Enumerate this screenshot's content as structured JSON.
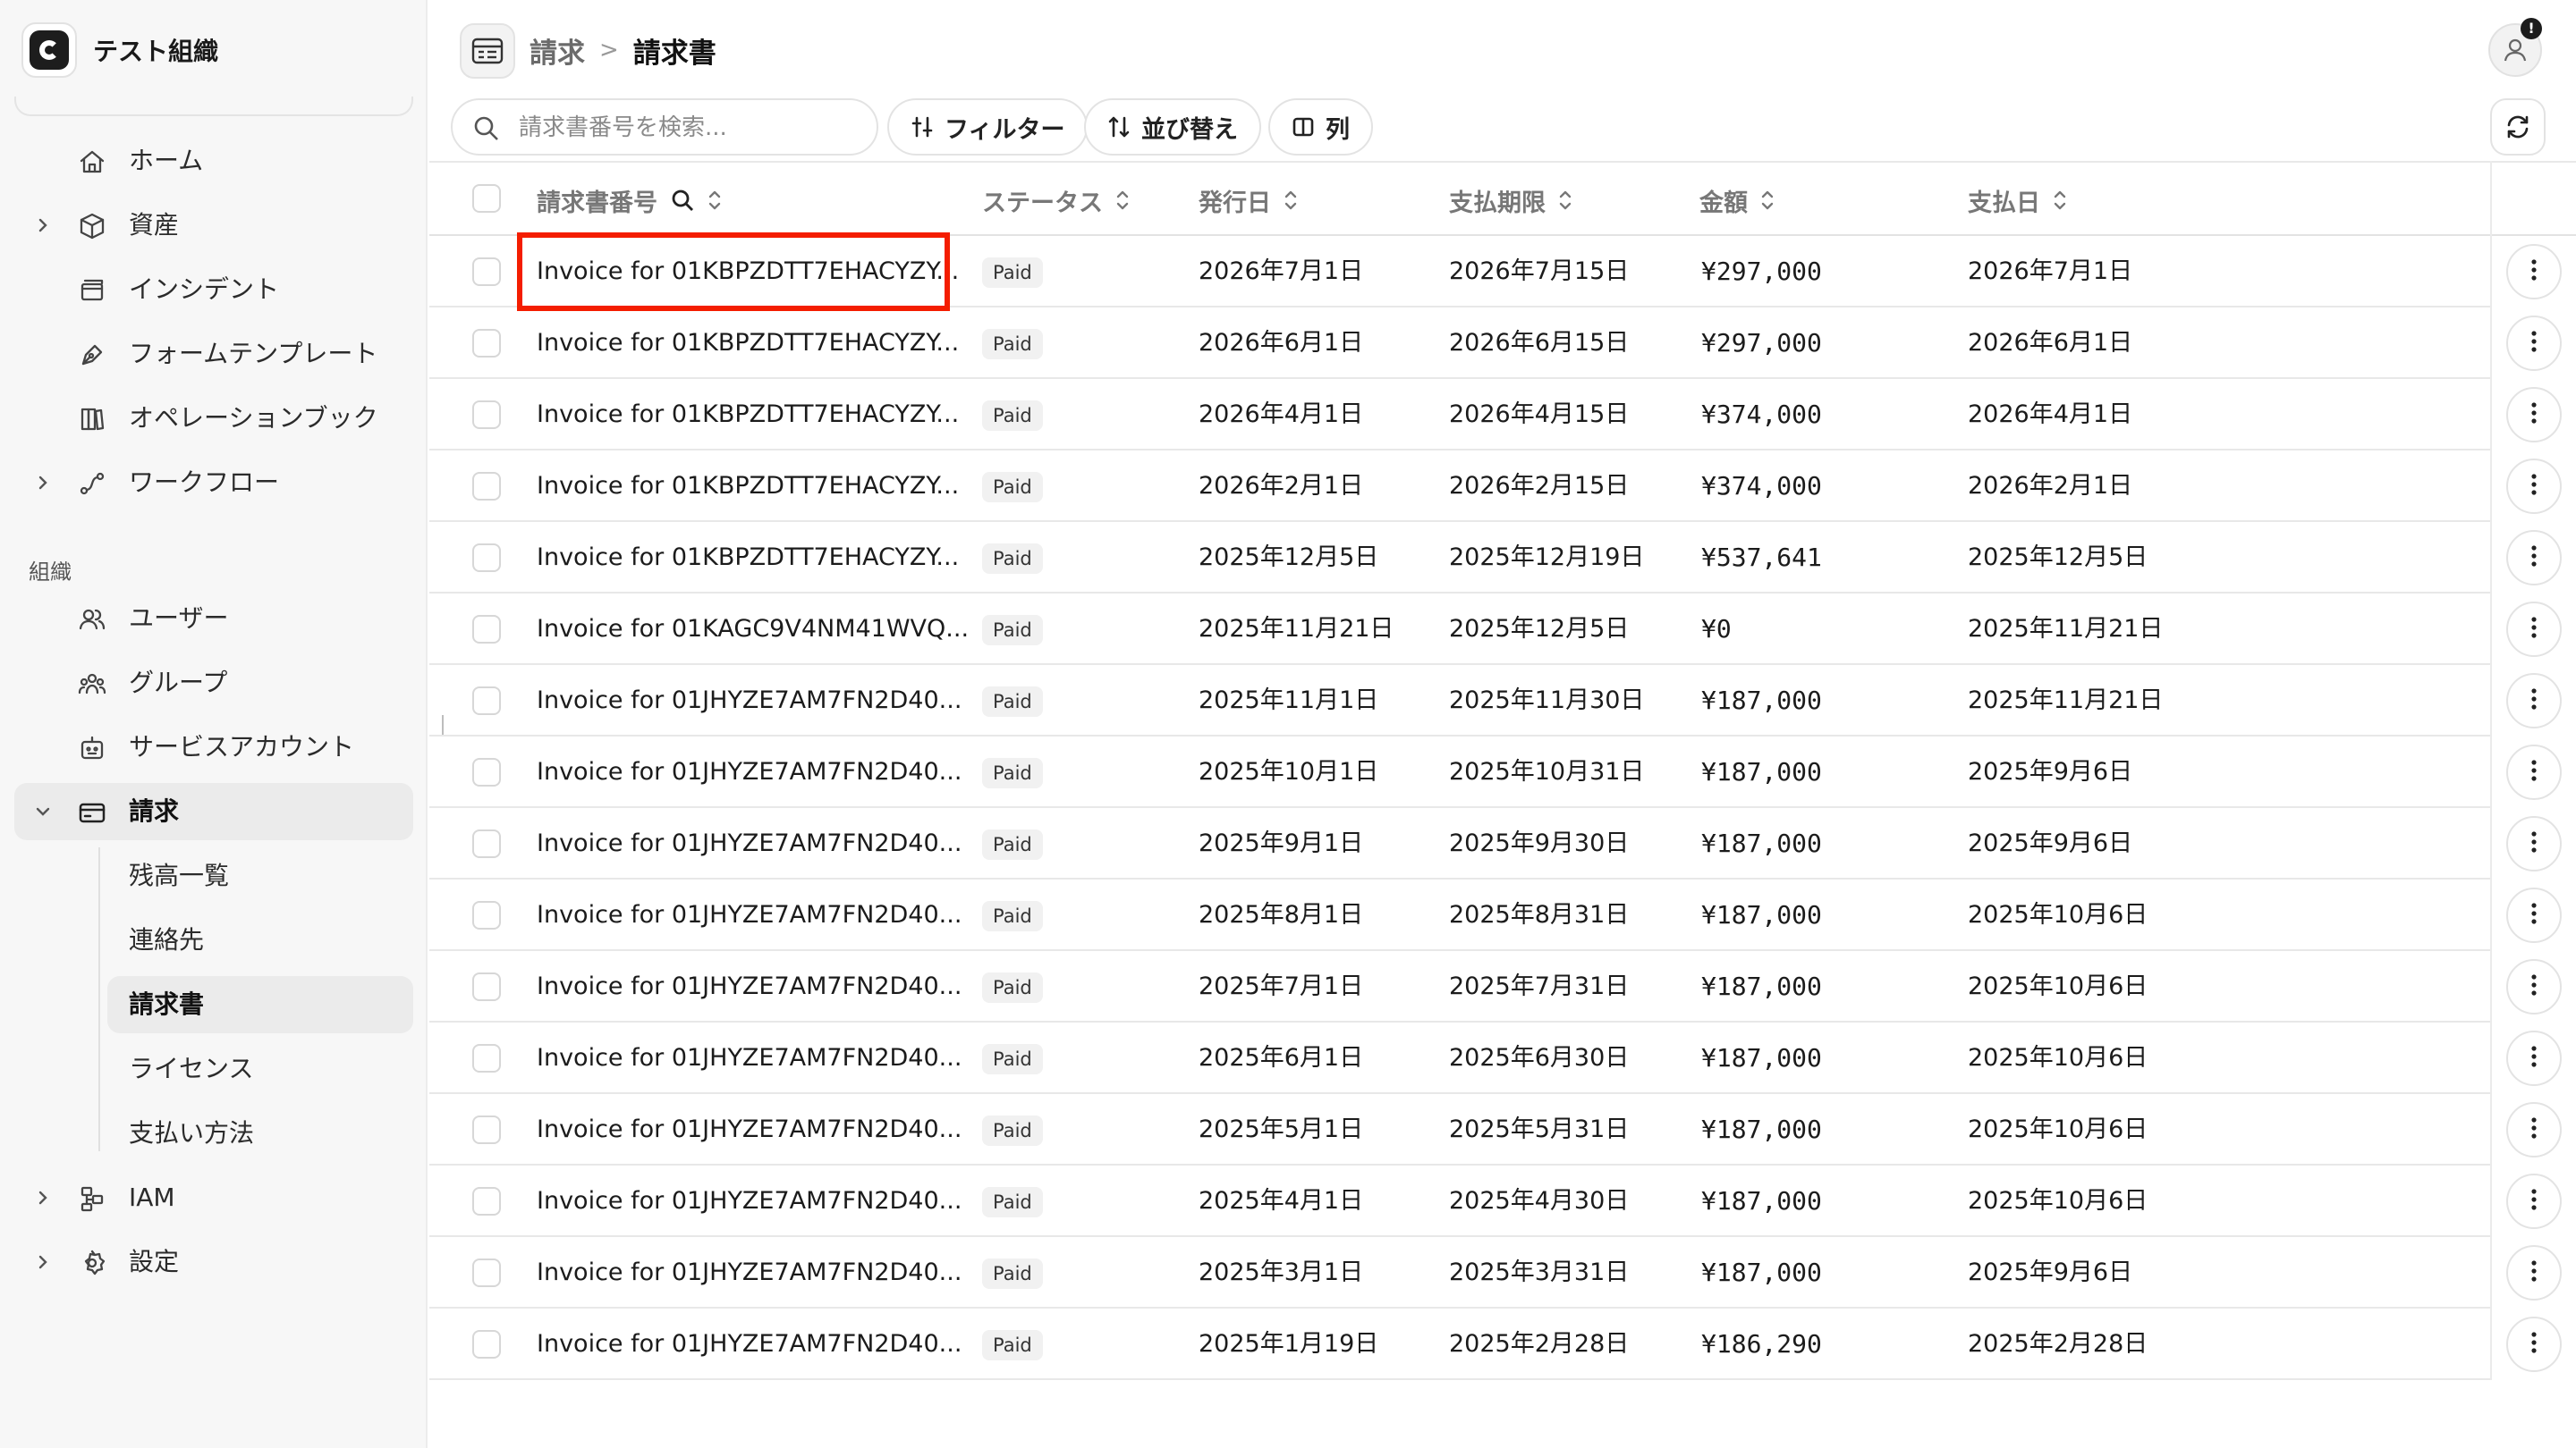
{
  "sidebar": {
    "org_name": "テスト組織",
    "section_label": "組織",
    "items": [
      {
        "key": "home",
        "label": "ホーム",
        "icon": "home-icon",
        "expandable": false
      },
      {
        "key": "assets",
        "label": "資産",
        "icon": "cube-icon",
        "expandable": true
      },
      {
        "key": "incidents",
        "label": "インシデント",
        "icon": "window-icon",
        "expandable": false
      },
      {
        "key": "form-templates",
        "label": "フォームテンプレート",
        "icon": "pen-icon",
        "expandable": false
      },
      {
        "key": "operation-book",
        "label": "オペレーションブック",
        "icon": "book-icon",
        "expandable": false
      },
      {
        "key": "workflow",
        "label": "ワークフロー",
        "icon": "workflow-icon",
        "expandable": true
      },
      {
        "key": "users",
        "label": "ユーザー",
        "icon": "users-icon",
        "expandable": false
      },
      {
        "key": "groups",
        "label": "グループ",
        "icon": "group-icon",
        "expandable": false
      },
      {
        "key": "service-accounts",
        "label": "サービスアカウント",
        "icon": "bot-icon",
        "expandable": false
      },
      {
        "key": "billing",
        "label": "請求",
        "icon": "card-icon",
        "expandable": true,
        "expanded": true,
        "active": true
      },
      {
        "key": "iam",
        "label": "IAM",
        "icon": "iam-icon",
        "expandable": true
      },
      {
        "key": "settings",
        "label": "設定",
        "icon": "gear-icon",
        "expandable": true
      }
    ],
    "billing_subitems": [
      {
        "key": "balance",
        "label": "残高一覧"
      },
      {
        "key": "contacts",
        "label": "連絡先"
      },
      {
        "key": "invoices",
        "label": "請求書",
        "active": true
      },
      {
        "key": "licenses",
        "label": "ライセンス"
      },
      {
        "key": "payment-methods",
        "label": "支払い方法"
      }
    ]
  },
  "header": {
    "breadcrumb_parent": "請求",
    "breadcrumb_separator": ">",
    "breadcrumb_current": "請求書",
    "avatar_badge": "!"
  },
  "toolbar": {
    "search_placeholder": "請求書番号を検索...",
    "filter_label": "フィルター",
    "sort_label": "並び替え",
    "columns_label": "列"
  },
  "table": {
    "columns": {
      "invoice_number": "請求書番号",
      "status": "ステータス",
      "issue_date": "発行日",
      "due_date": "支払期限",
      "amount": "金額",
      "paid_date": "支払日"
    },
    "rows": [
      {
        "invoice": "Invoice for 01KBPZDTT7EHACYZY...",
        "status": "Paid",
        "issue_date": "2026年7月1日",
        "due_date": "2026年7月15日",
        "amount": "¥297,000",
        "paid_date": "2026年7月1日"
      },
      {
        "invoice": "Invoice for 01KBPZDTT7EHACYZY...",
        "status": "Paid",
        "issue_date": "2026年6月1日",
        "due_date": "2026年6月15日",
        "amount": "¥297,000",
        "paid_date": "2026年6月1日"
      },
      {
        "invoice": "Invoice for 01KBPZDTT7EHACYZY...",
        "status": "Paid",
        "issue_date": "2026年4月1日",
        "due_date": "2026年4月15日",
        "amount": "¥374,000",
        "paid_date": "2026年4月1日"
      },
      {
        "invoice": "Invoice for 01KBPZDTT7EHACYZY...",
        "status": "Paid",
        "issue_date": "2026年2月1日",
        "due_date": "2026年2月15日",
        "amount": "¥374,000",
        "paid_date": "2026年2月1日"
      },
      {
        "invoice": "Invoice for 01KBPZDTT7EHACYZY...",
        "status": "Paid",
        "issue_date": "2025年12月5日",
        "due_date": "2025年12月19日",
        "amount": "¥537,641",
        "paid_date": "2025年12月5日"
      },
      {
        "invoice": "Invoice for 01KAGC9V4NM41WVQ...",
        "status": "Paid",
        "issue_date": "2025年11月21日",
        "due_date": "2025年12月5日",
        "amount": "¥0",
        "paid_date": "2025年11月21日"
      },
      {
        "invoice": "Invoice for 01JHYZE7AM7FN2D40...",
        "status": "Paid",
        "issue_date": "2025年11月1日",
        "due_date": "2025年11月30日",
        "amount": "¥187,000",
        "paid_date": "2025年11月21日"
      },
      {
        "invoice": "Invoice for 01JHYZE7AM7FN2D40...",
        "status": "Paid",
        "issue_date": "2025年10月1日",
        "due_date": "2025年10月31日",
        "amount": "¥187,000",
        "paid_date": "2025年9月6日"
      },
      {
        "invoice": "Invoice for 01JHYZE7AM7FN2D40...",
        "status": "Paid",
        "issue_date": "2025年9月1日",
        "due_date": "2025年9月30日",
        "amount": "¥187,000",
        "paid_date": "2025年9月6日"
      },
      {
        "invoice": "Invoice for 01JHYZE7AM7FN2D40...",
        "status": "Paid",
        "issue_date": "2025年8月1日",
        "due_date": "2025年8月31日",
        "amount": "¥187,000",
        "paid_date": "2025年10月6日"
      },
      {
        "invoice": "Invoice for 01JHYZE7AM7FN2D40...",
        "status": "Paid",
        "issue_date": "2025年7月1日",
        "due_date": "2025年7月31日",
        "amount": "¥187,000",
        "paid_date": "2025年10月6日"
      },
      {
        "invoice": "Invoice for 01JHYZE7AM7FN2D40...",
        "status": "Paid",
        "issue_date": "2025年6月1日",
        "due_date": "2025年6月30日",
        "amount": "¥187,000",
        "paid_date": "2025年10月6日"
      },
      {
        "invoice": "Invoice for 01JHYZE7AM7FN2D40...",
        "status": "Paid",
        "issue_date": "2025年5月1日",
        "due_date": "2025年5月31日",
        "amount": "¥187,000",
        "paid_date": "2025年10月6日"
      },
      {
        "invoice": "Invoice for 01JHYZE7AM7FN2D40...",
        "status": "Paid",
        "issue_date": "2025年4月1日",
        "due_date": "2025年4月30日",
        "amount": "¥187,000",
        "paid_date": "2025年10月6日"
      },
      {
        "invoice": "Invoice for 01JHYZE7AM7FN2D40...",
        "status": "Paid",
        "issue_date": "2025年3月1日",
        "due_date": "2025年3月31日",
        "amount": "¥187,000",
        "paid_date": "2025年9月6日"
      },
      {
        "invoice": "Invoice for 01JHYZE7AM7FN2D40...",
        "status": "Paid",
        "issue_date": "2025年1月19日",
        "due_date": "2025年2月28日",
        "amount": "¥186,290",
        "paid_date": "2025年2月28日"
      }
    ]
  },
  "colors": {
    "highlight": "#f41d00",
    "sidebar_bg": "#f7f7f7",
    "active_bg": "#ebebeb"
  }
}
